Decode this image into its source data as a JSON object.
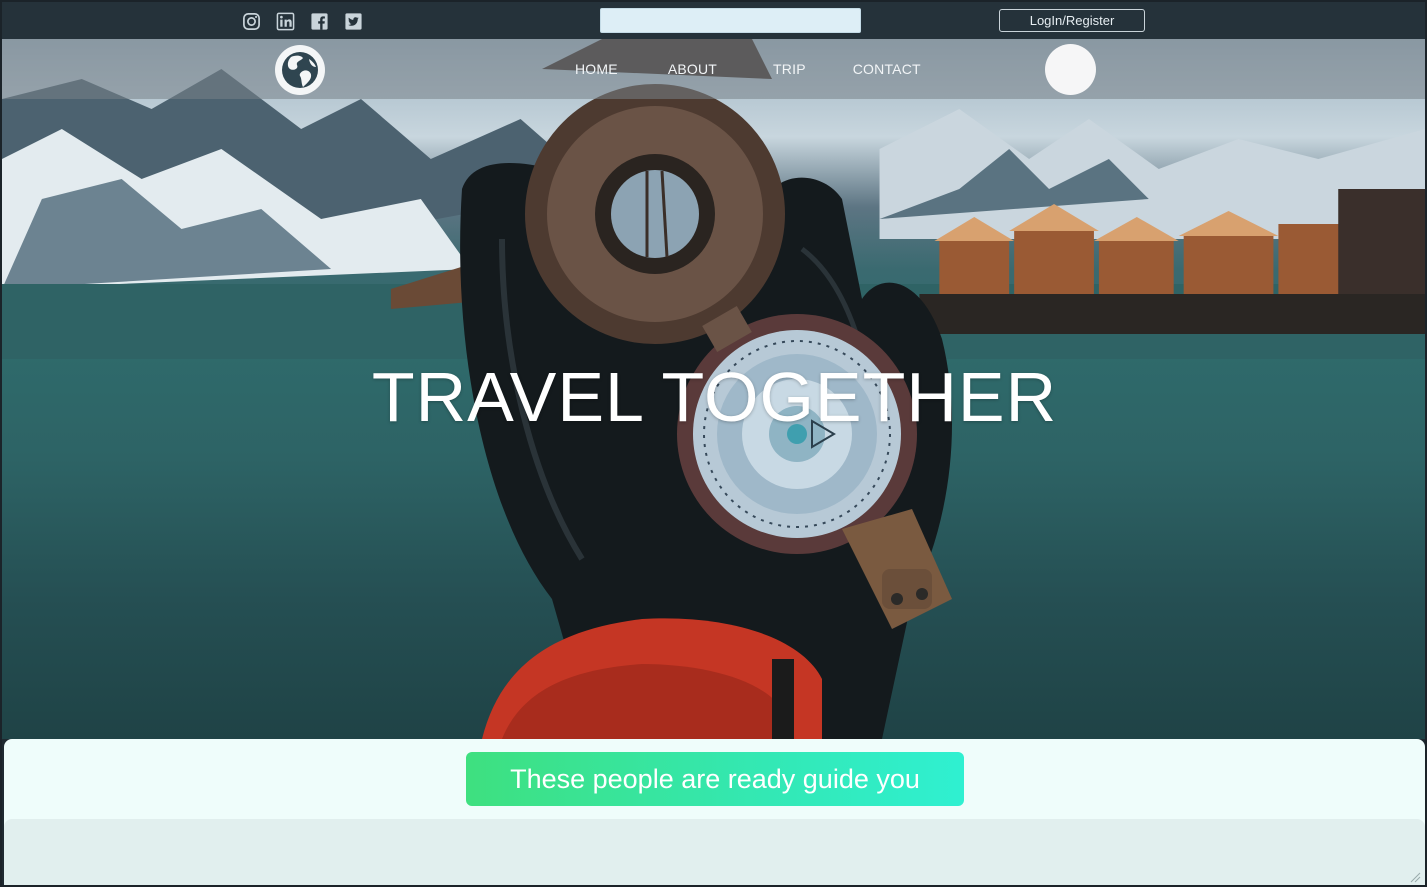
{
  "topbar": {
    "social_icons": [
      "instagram-icon",
      "linkedin-icon",
      "facebook-icon",
      "twitter-icon"
    ],
    "search": {
      "value": "",
      "placeholder": ""
    },
    "login_label": "LogIn/Register"
  },
  "navbar": {
    "logo_icon": "globe-icon",
    "links": [
      "HOME",
      "ABOUT",
      "TRIP",
      "CONTACT"
    ]
  },
  "hero": {
    "title": "TRAVEL TOGETHER"
  },
  "guide": {
    "banner_text": "These people are ready guide you"
  },
  "colors": {
    "topbar_bg": "#25323a",
    "banner_start": "#3ee07f",
    "banner_end": "#2ff0d1",
    "section_bg": "#effdfb",
    "panel_bg": "#e1efee"
  }
}
